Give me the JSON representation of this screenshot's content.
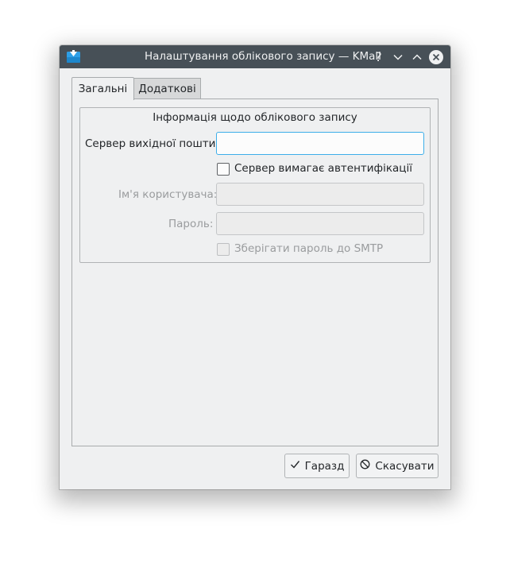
{
  "window": {
    "title": "Налаштування облікового запису — KMail"
  },
  "titlebar": {
    "help_glyph": "?",
    "icons": [
      "kmail-app-icon",
      "help-icon",
      "minimize-icon",
      "maximize-icon",
      "close-icon"
    ]
  },
  "tabs": [
    {
      "label": "Загальні",
      "active": true
    },
    {
      "label": "Додаткові",
      "active": false
    }
  ],
  "group": {
    "title": "Інформація щодо облікового запису",
    "server_label": "Сервер вихідної пошти:",
    "server_value": "",
    "auth_label": "Сервер вимагає автентифікації",
    "auth_checked": false,
    "username_label": "Ім'я користувача:",
    "username_value": "",
    "password_label": "Пароль:",
    "password_value": "",
    "store_label": "Зберігати пароль до SMTP",
    "store_checked": false
  },
  "buttons": {
    "ok": "Гаразд",
    "cancel": "Скасувати"
  },
  "colors": {
    "titlebar": "#475057",
    "window": "#eff0f1",
    "focus": "#3daee9",
    "icon_blue": "#2d9fe6"
  }
}
